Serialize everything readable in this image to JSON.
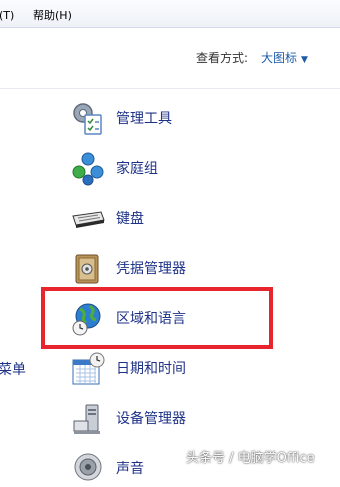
{
  "menubar": {
    "tools_partial": "(T)",
    "help": "帮助(H)"
  },
  "view": {
    "label": "查看方式:",
    "value": "大图标"
  },
  "left_partial_label": "菜单",
  "items": [
    {
      "icon": "admin-tools-icon",
      "label": "管理工具"
    },
    {
      "icon": "homegroup-icon",
      "label": "家庭组"
    },
    {
      "icon": "keyboard-icon",
      "label": "键盘"
    },
    {
      "icon": "credential-manager-icon",
      "label": "凭据管理器"
    },
    {
      "icon": "region-language-icon",
      "label": "区域和语言"
    },
    {
      "icon": "date-time-icon",
      "label": "日期和时间"
    },
    {
      "icon": "device-manager-icon",
      "label": "设备管理器"
    },
    {
      "icon": "sound-icon",
      "label": "声音"
    }
  ],
  "watermark": "头条号 / 电脑学Office",
  "colors": {
    "highlight": "#e8252c",
    "link": "#1e3287"
  }
}
